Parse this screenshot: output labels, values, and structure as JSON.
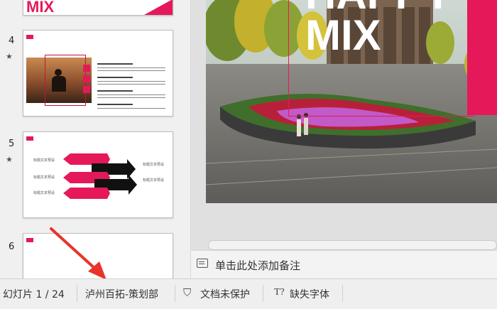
{
  "thumbnails": {
    "slide3_title": "MIX",
    "items": [
      {
        "number": "4"
      },
      {
        "number": "5"
      },
      {
        "number": "6"
      }
    ],
    "slide5_labels": [
      "标题文本预设",
      "标题文本预设",
      "标题文本预设",
      "标题文本预设",
      "标题文本预设"
    ]
  },
  "main_slide": {
    "title_line1": "HAPPY",
    "title_line2": "MIX"
  },
  "notes": {
    "placeholder": "单击此处添加备注"
  },
  "status_bar": {
    "slide_counter": "幻灯片 1 / 24",
    "author": "泸州百拓-策划部",
    "protection": "文档未保护",
    "missing_fonts": "缺失字体"
  },
  "colors": {
    "accent": "#e5195a",
    "annotation_arrow": "#e8342a"
  }
}
